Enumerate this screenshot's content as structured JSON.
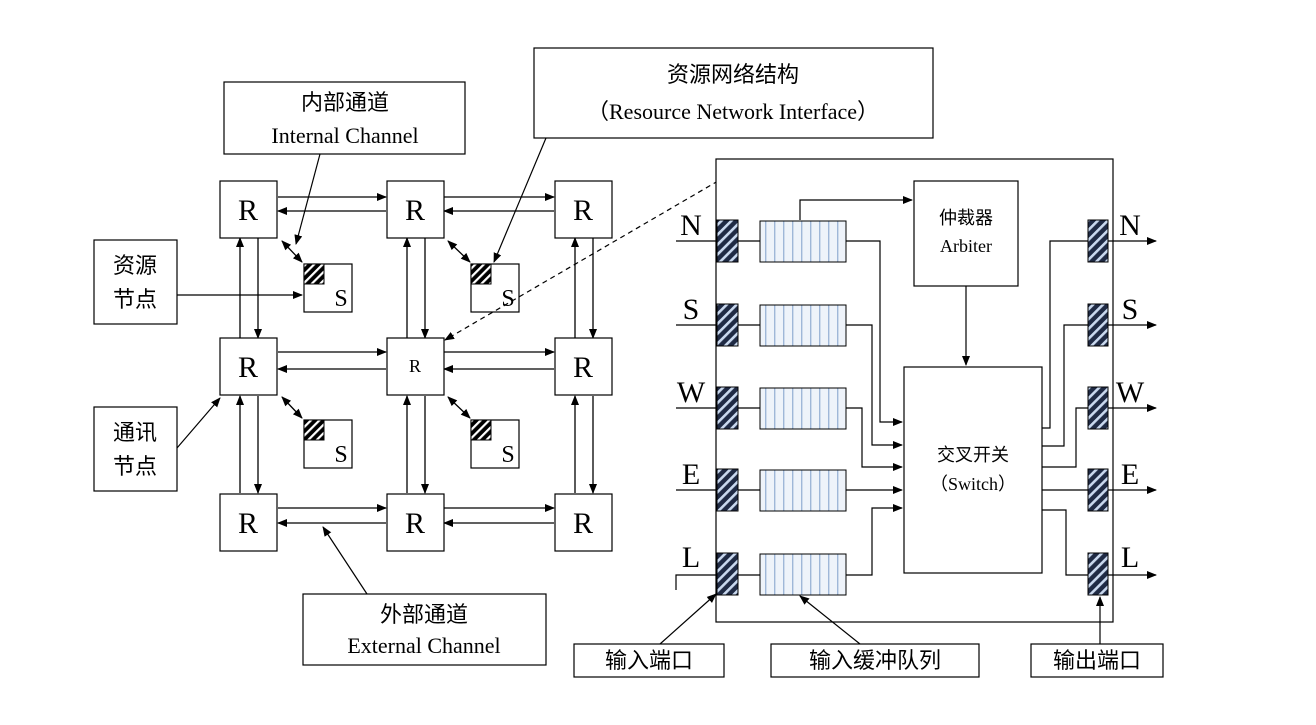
{
  "mesh": {
    "router_label": "R",
    "center_router_label": "R",
    "resource_label": "S"
  },
  "callouts": {
    "internal_channel": {
      "zh": "内部通道",
      "en": "Internal Channel"
    },
    "resource_network_interface": {
      "zh": "资源网络结构",
      "en": "（Resource Network Interface）"
    },
    "resource_node": {
      "line1": "资源",
      "line2": "节点"
    },
    "comm_node": {
      "line1": "通讯",
      "line2": "节点"
    },
    "external_channel": {
      "zh": "外部通道",
      "en": "External Channel"
    }
  },
  "router_detail": {
    "arbiter": {
      "zh": "仲裁器",
      "en": "Arbiter"
    },
    "switch": {
      "zh": "交叉开关",
      "en": "（Switch）"
    },
    "input_ports": [
      "N",
      "S",
      "W",
      "E",
      "L"
    ],
    "output_ports": [
      "N",
      "S",
      "W",
      "E",
      "L"
    ],
    "input_port_label": "输入端口",
    "input_buffer_label": "输入缓冲队列",
    "output_port_label": "输出端口"
  },
  "colors": {
    "line": "#000000",
    "port_fill": "#1f2a44",
    "port_stripe": "#c9d8ee",
    "buffer_stripe": "#9fb7d8",
    "buffer_fill": "#eef3fa"
  }
}
